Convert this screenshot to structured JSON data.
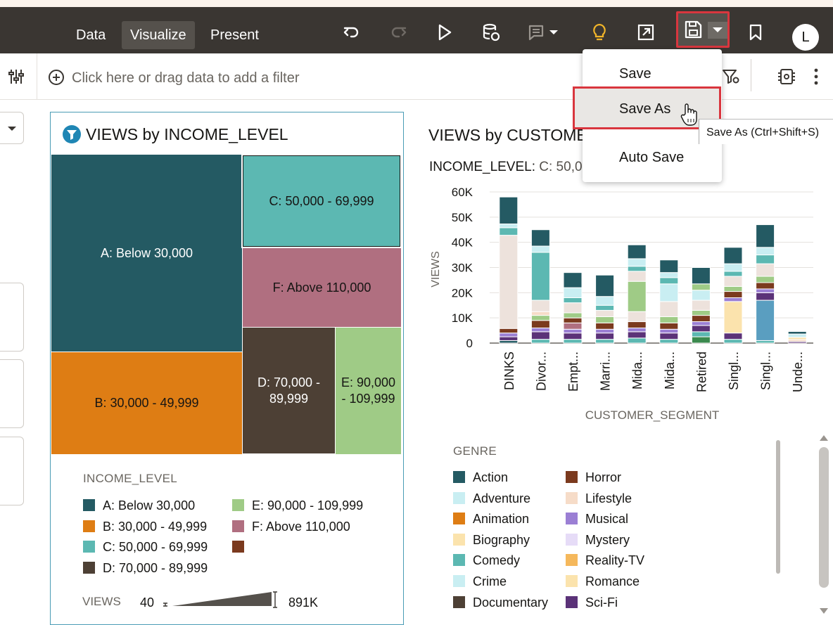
{
  "toolbar": {
    "tabs": [
      "Data",
      "Visualize",
      "Present"
    ],
    "active_tab": "Visualize",
    "avatar_initial": "L",
    "icons": [
      "undo-icon",
      "redo-icon",
      "play-icon",
      "refresh-data-icon",
      "comment-icon",
      "insights-bulb-icon",
      "export-icon",
      "save-icon",
      "bookmark-icon"
    ]
  },
  "filterbar": {
    "placeholder": "Click here or drag data to add a filter"
  },
  "save_menu": {
    "items": [
      "Save",
      "Save As",
      "Auto Save"
    ],
    "hovered": "Save As",
    "tooltip": "Save As (Ctrl+Shift+S)"
  },
  "treemap": {
    "title": "VIEWS by INCOME_LEVEL",
    "legend_title": "INCOME_LEVEL",
    "tiles": [
      {
        "label": "A: Below 30,000",
        "color": "#245a63"
      },
      {
        "label": "C: 50,000 - 69,999",
        "color": "#5cb8b2"
      },
      {
        "label": "F: Above 110,000",
        "color": "#b06f80"
      },
      {
        "label": "B: 30,000 - 49,999",
        "color": "#de7d14"
      },
      {
        "label": "D: 70,000 - 89,999",
        "color": "#4d4035"
      },
      {
        "label": "E: 90,000 - 109,999",
        "color": "#9fcb86"
      }
    ],
    "legend": [
      {
        "label": "A: Below 30,000",
        "color": "#245a63"
      },
      {
        "label": "B: 30,000 - 49,999",
        "color": "#de7d14"
      },
      {
        "label": "C: 50,000 - 69,999",
        "color": "#5cb8b2"
      },
      {
        "label": "D: 70,000 - 89,999",
        "color": "#4d4035"
      },
      {
        "label": "E: 90,000 - 109,999",
        "color": "#9fcb86"
      },
      {
        "label": "F: Above 110,000",
        "color": "#b06f80"
      },
      {
        "label": "",
        "color": "#7b3a1e"
      }
    ],
    "size_legend": {
      "label": "VIEWS",
      "min": "40",
      "max": "891K"
    }
  },
  "chart_data": {
    "type": "bar",
    "title": "VIEWS by CUSTOME",
    "subtitle_key": "INCOME_LEVEL:",
    "subtitle_value": "C: 50,0",
    "xlabel": "CUSTOMER_SEGMENT",
    "ylabel": "VIEWS",
    "ylim": [
      0,
      60000
    ],
    "y_ticks": [
      "0",
      "10K",
      "20K",
      "30K",
      "40K",
      "50K",
      "60K"
    ],
    "categories": [
      "DINKS",
      "Divor...",
      "Empt...",
      "Marri...",
      "Mida...",
      "Mida...",
      "Retired",
      "Singl...",
      "Singl...",
      "Unde..."
    ],
    "stacked": true,
    "totals": [
      58000,
      45000,
      28000,
      27000,
      39000,
      33000,
      30000,
      38000,
      47000,
      4600
    ],
    "segments": [
      [
        [
          1000,
          "#245a63"
        ],
        [
          1500,
          "#5b3278"
        ],
        [
          1500,
          "#9b7fd4"
        ],
        [
          1800,
          "#7b3a1e"
        ],
        [
          37000,
          "#ede2dc"
        ],
        [
          3000,
          "#5cb8b2"
        ],
        [
          1500,
          "#c9eef2"
        ],
        [
          10700,
          "#245a63"
        ]
      ],
      [
        [
          1500,
          "#5cb8b2"
        ],
        [
          3000,
          "#5b3278"
        ],
        [
          1500,
          "#9b7fd4"
        ],
        [
          3000,
          "#7b3a1e"
        ],
        [
          2000,
          "#9fcb86"
        ],
        [
          1500,
          "#f6dcc8"
        ],
        [
          4500,
          "#ede2dc"
        ],
        [
          19000,
          "#5cb8b2"
        ],
        [
          2500,
          "#c9eef2"
        ],
        [
          6500,
          "#245a63"
        ]
      ],
      [
        [
          1500,
          "#5cb8b2"
        ],
        [
          2500,
          "#5b3278"
        ],
        [
          1500,
          "#9b7fd4"
        ],
        [
          2500,
          "#b06f80"
        ],
        [
          2000,
          "#7b3a1e"
        ],
        [
          2000,
          "#9fcb86"
        ],
        [
          4000,
          "#ede2dc"
        ],
        [
          2000,
          "#5cb8b2"
        ],
        [
          4000,
          "#c9eef2"
        ],
        [
          6000,
          "#245a63"
        ]
      ],
      [
        [
          1500,
          "#5cb8b2"
        ],
        [
          2500,
          "#5b3278"
        ],
        [
          1500,
          "#9b7fd4"
        ],
        [
          2500,
          "#7b3a1e"
        ],
        [
          2500,
          "#9fcb86"
        ],
        [
          2500,
          "#ede2dc"
        ],
        [
          2000,
          "#5cb8b2"
        ],
        [
          3500,
          "#c9eef2"
        ],
        [
          8500,
          "#245a63"
        ]
      ],
      [
        [
          2000,
          "#5cb8b2"
        ],
        [
          2500,
          "#5b3278"
        ],
        [
          1500,
          "#9b7fd4"
        ],
        [
          2500,
          "#7b3a1e"
        ],
        [
          4000,
          "#ede2dc"
        ],
        [
          12000,
          "#9fcb86"
        ],
        [
          4000,
          "#ede2dc"
        ],
        [
          2000,
          "#5cb8b2"
        ],
        [
          3000,
          "#c9eef2"
        ],
        [
          5500,
          "#245a63"
        ]
      ],
      [
        [
          1500,
          "#5cb8b2"
        ],
        [
          2500,
          "#5b3278"
        ],
        [
          1500,
          "#9b7fd4"
        ],
        [
          2500,
          "#7b3a1e"
        ],
        [
          2500,
          "#9fcb86"
        ],
        [
          6000,
          "#ede2dc"
        ],
        [
          7000,
          "#c9eef2"
        ],
        [
          2500,
          "#5cb8b2"
        ],
        [
          2000,
          "#c9eef2"
        ],
        [
          5000,
          "#245a63"
        ]
      ],
      [
        [
          2500,
          "#3b8a4e"
        ],
        [
          2000,
          "#5cb8b2"
        ],
        [
          2500,
          "#5b3278"
        ],
        [
          1500,
          "#9b7fd4"
        ],
        [
          2500,
          "#7b3a1e"
        ],
        [
          2000,
          "#9fcb86"
        ],
        [
          4000,
          "#ede2dc"
        ],
        [
          4000,
          "#c9eef2"
        ],
        [
          2500,
          "#9fcb86"
        ],
        [
          6500,
          "#245a63"
        ]
      ],
      [
        [
          1500,
          "#5cb8b2"
        ],
        [
          2500,
          "#5b3278"
        ],
        [
          12500,
          "#fbe3ad"
        ],
        [
          1500,
          "#9b7fd4"
        ],
        [
          2500,
          "#7b3a1e"
        ],
        [
          2000,
          "#9fcb86"
        ],
        [
          4000,
          "#ede2dc"
        ],
        [
          2000,
          "#5cb8b2"
        ],
        [
          3000,
          "#c9eef2"
        ],
        [
          6500,
          "#245a63"
        ]
      ],
      [
        [
          1000,
          "#5cb8b2"
        ],
        [
          16000,
          "#5a9ec0"
        ],
        [
          3000,
          "#5b3278"
        ],
        [
          1500,
          "#9b7fd4"
        ],
        [
          2500,
          "#7b3a1e"
        ],
        [
          2500,
          "#9fcb86"
        ],
        [
          5000,
          "#ede2dc"
        ],
        [
          3500,
          "#5cb8b2"
        ],
        [
          3000,
          "#c9eef2"
        ],
        [
          9000,
          "#245a63"
        ]
      ],
      [
        [
          600,
          "#5b3278"
        ],
        [
          800,
          "#f6dcc8"
        ],
        [
          900,
          "#fbe3ad"
        ],
        [
          1300,
          "#c9eef2"
        ],
        [
          1000,
          "#245a63"
        ]
      ]
    ]
  },
  "genre_legend": {
    "title": "GENRE",
    "items": [
      {
        "label": "Action",
        "color": "#245a63"
      },
      {
        "label": "Adventure",
        "color": "#c9eef2"
      },
      {
        "label": "Animation",
        "color": "#de7d14"
      },
      {
        "label": "Biography",
        "color": "#fbe3ad"
      },
      {
        "label": "Comedy",
        "color": "#5cb8b2"
      },
      {
        "label": "Crime",
        "color": "#c9eef2"
      },
      {
        "label": "Documentary",
        "color": "#4d4035"
      },
      {
        "label": "Horror",
        "color": "#7b3a1e"
      },
      {
        "label": "Lifestyle",
        "color": "#f6dcc8"
      },
      {
        "label": "Musical",
        "color": "#9b7fd4"
      },
      {
        "label": "Mystery",
        "color": "#e6dcf7"
      },
      {
        "label": "Reality-TV",
        "color": "#f5b85c"
      },
      {
        "label": "Romance",
        "color": "#fbe3ad"
      },
      {
        "label": "Sci-Fi",
        "color": "#5b3278"
      }
    ]
  }
}
